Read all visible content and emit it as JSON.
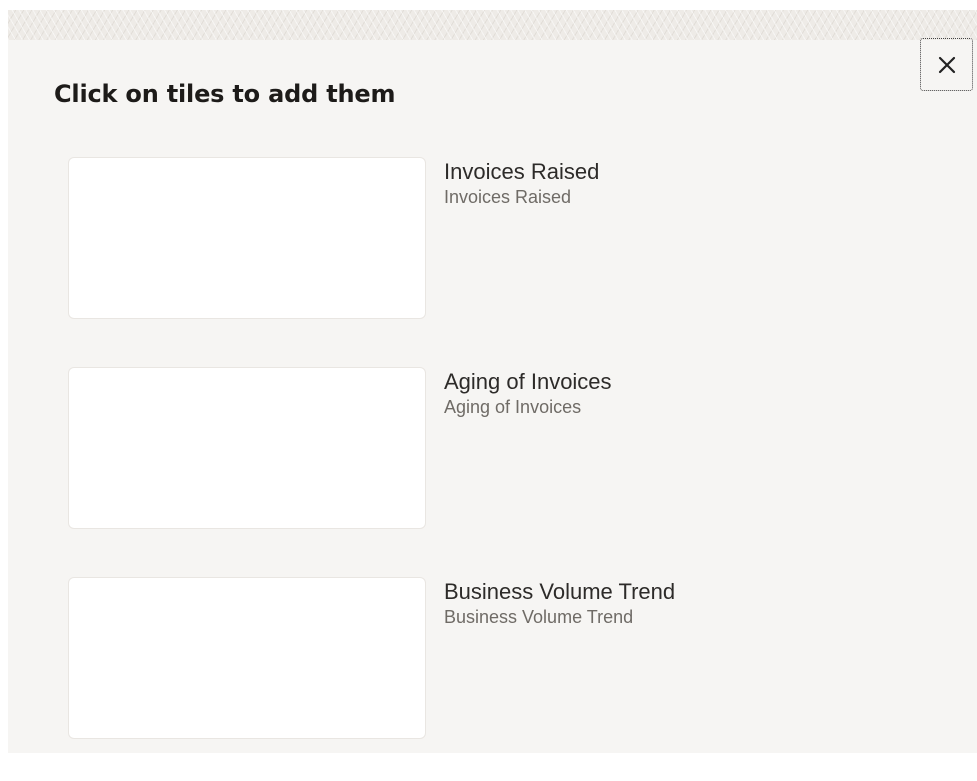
{
  "dialog": {
    "title": "Click on tiles to add them",
    "close_icon": "close-icon",
    "tiles": [
      {
        "title": "Invoices Raised",
        "subtitle": "Invoices Raised"
      },
      {
        "title": "Aging of Invoices",
        "subtitle": "Aging of Invoices"
      },
      {
        "title": "Business Volume Trend",
        "subtitle": "Business Volume Trend"
      }
    ]
  },
  "colors": {
    "panel_background": "#f6f5f3",
    "title_text": "#1d1b19",
    "subtitle_text": "#6f6b66"
  }
}
